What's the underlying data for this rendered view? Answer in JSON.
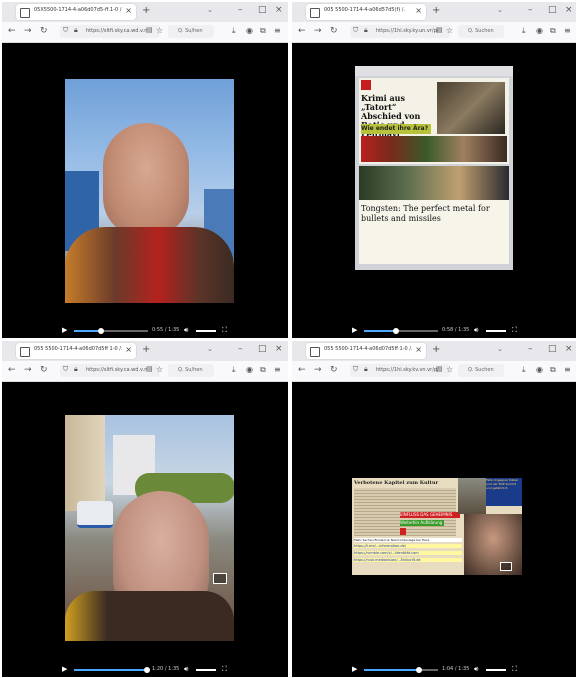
{
  "windows": [
    {
      "tab_title": "05X5500-1714-4-a06d07d5-ff.1-0 /.",
      "url": "https://sltfi.sky.ca.wd.v.n",
      "search_placeholder": "Q. Su/hen",
      "time": "0:55 / 1:35",
      "progress": 0.35
    },
    {
      "tab_title": "005 5500-1714-4-a06d57d5(f) /.",
      "url": "https://1hi.sky.ky.un.vr/p/",
      "search_placeholder": "Q. Suchen",
      "time": "0:58 / 1:35",
      "progress": 0.42,
      "screen": {
        "headline": "Krimi aus „Tatort“ Abschied von Batic und Leitmayr",
        "subhead": "Wie endet ihre Ära?",
        "lower_title": "Tongsten: The perfect metal for bullets and missiles"
      }
    },
    {
      "tab_title": "055 5500-1714-4-a06d07d5ff 1-0 /.",
      "url": "https://sltfi.sky.ca.wd.v.n",
      "search_placeholder": "Q. Su/hen",
      "time": "1:20 / 1:35",
      "progress": 0.98
    },
    {
      "tab_title": "055 5500-1714-4-a06d07d5ff 1-0 /.",
      "url": "https://1hi.sky.kv.vn.vr/p/",
      "search_placeholder": "Q. Suchen",
      "time": "1:04 / 1:35",
      "progress": 0.74,
      "screen": {
        "headline": "Verbotene Kapitel zum Kultur",
        "banner_red": "EINFLUSS DAS GEHEIMNIS",
        "banner_green": "Weiterhin Aufklärung",
        "footer_line": "Mehr Sachen Einstein & Nachrichtenlage bei Hans",
        "links": [
          "https://t.me/...information.de/",
          "https://rumble.com/c/...Identität.com",
          "https://rusk.mediavision/...Einkunft.de"
        ],
        "side_text": "Falls Ungegner Daten und der EDP kommt und gefahrlich"
      }
    }
  ],
  "icons": {
    "play": "play-icon",
    "volume": "volume-icon",
    "fullscreen": "fullscreen-icon",
    "pip": "picture-in-picture-icon"
  },
  "colors": {
    "accent": "#4aa8ff",
    "tabbar": "#e8e8ec",
    "toolbar": "#f9f9fb"
  }
}
